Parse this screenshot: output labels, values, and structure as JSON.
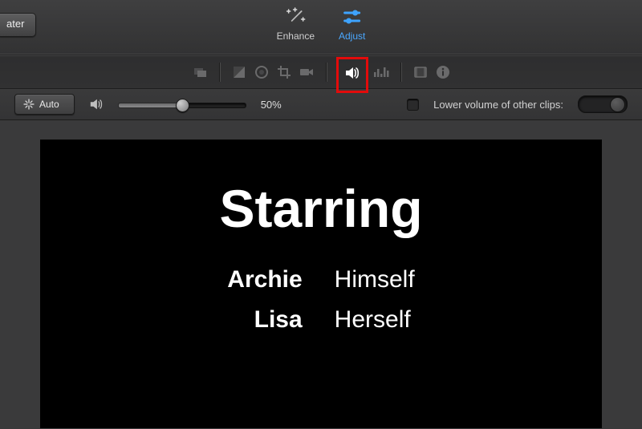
{
  "topbar": {
    "theater_label": "ater",
    "enhance_label": "Enhance",
    "adjust_label": "Adjust"
  },
  "toolstrip": {
    "icons": [
      "video-overlay-icon",
      "contrast-icon",
      "color-wheel-icon",
      "crop-icon",
      "camera-icon",
      "volume-icon",
      "equalizer-icon",
      "film-icon",
      "info-icon"
    ],
    "selected_index": 5
  },
  "adjust": {
    "auto_label": "Auto",
    "volume_percent": "50%",
    "volume_fraction": 0.5,
    "lower_label": "Lower volume of other clips:",
    "lower_checked": false,
    "lower_toggle_on": false
  },
  "preview": {
    "title": "Starring",
    "credits": [
      {
        "name": "Archie",
        "role": "Himself"
      },
      {
        "name": "Lisa",
        "role": "Herself"
      }
    ]
  }
}
